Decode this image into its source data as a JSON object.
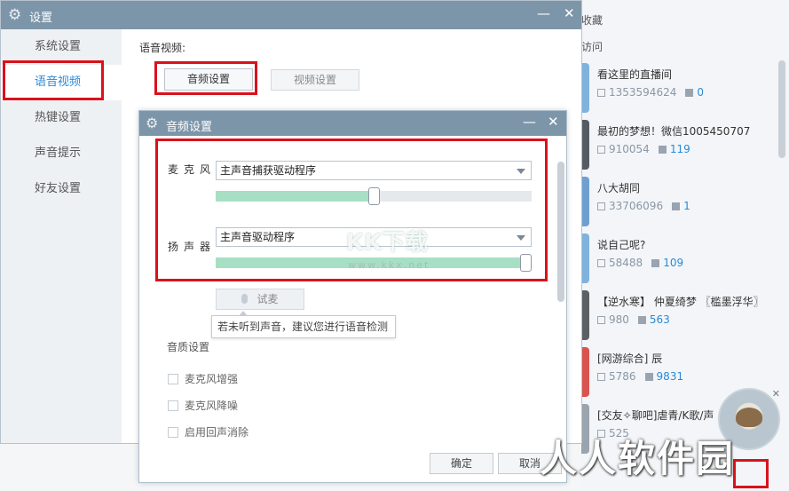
{
  "colors": {
    "accent": "#2b8ad8",
    "titlebar": "#7c95a9",
    "highlight_box": "#d9121b",
    "slider_fill": "#a7dfc4"
  },
  "settings_window": {
    "title": "设置",
    "minimize_icon": "minimize-icon",
    "close_icon": "close-icon",
    "sidebar": [
      {
        "label": "系统设置"
      },
      {
        "label": "语音视频",
        "active": true
      },
      {
        "label": "热键设置"
      },
      {
        "label": "声音提示"
      },
      {
        "label": "好友设置"
      }
    ],
    "section_title": "语音视频:",
    "tabs": {
      "audio": "音频设置",
      "video": "视频设置"
    }
  },
  "audio_dialog": {
    "title": "音频设置",
    "microphone": {
      "label": "麦克风",
      "device": "主声音捕获驱动程序",
      "level": 0.5
    },
    "speaker": {
      "label": "扬声器",
      "device": "主声音驱动程序",
      "level": 1.0
    },
    "test_button": "试麦",
    "tooltip": "若未听到声音，建议您进行语音检测",
    "quality_title": "音质设置",
    "options": [
      {
        "label": "麦克风增强",
        "checked": false
      },
      {
        "label": "麦克风降噪",
        "checked": false
      },
      {
        "label": "启用回声消除",
        "checked": false
      }
    ],
    "ok": "确定",
    "cancel": "取消"
  },
  "room_panel": {
    "header_1": "收藏",
    "header_2": "访问",
    "rooms": [
      {
        "title": "看这里的直播间",
        "id": "1353594624",
        "online": "0",
        "thumb_color": "#7fb3de"
      },
      {
        "title": "最初的梦想！微信1005450707",
        "id": "910054",
        "online": "119",
        "thumb_color": "#555b62"
      },
      {
        "title": "八大胡同",
        "id": "33706096",
        "online": "1",
        "thumb_color": "#6f9fd0"
      },
      {
        "title": "说自己呢?",
        "id": "58488",
        "online": "109",
        "thumb_color": "#7fb3de"
      },
      {
        "title": "【逆水寒】 仲夏绮梦 〖槛墨浮华〗",
        "id": "980",
        "online": "563",
        "thumb_color": "#5c5f63"
      },
      {
        "title": "[网游综合]  辰",
        "id": "5786",
        "online": "9831",
        "thumb_color": "#d9534f"
      },
      {
        "title": "[交友✧聊吧]虐青/K歌/声",
        "id": "525",
        "online": "",
        "thumb_color": "#9aa4ae"
      }
    ]
  },
  "watermarks": {
    "kk": "KK下载",
    "url": "www.kkx.net",
    "site": "人人软件园"
  }
}
